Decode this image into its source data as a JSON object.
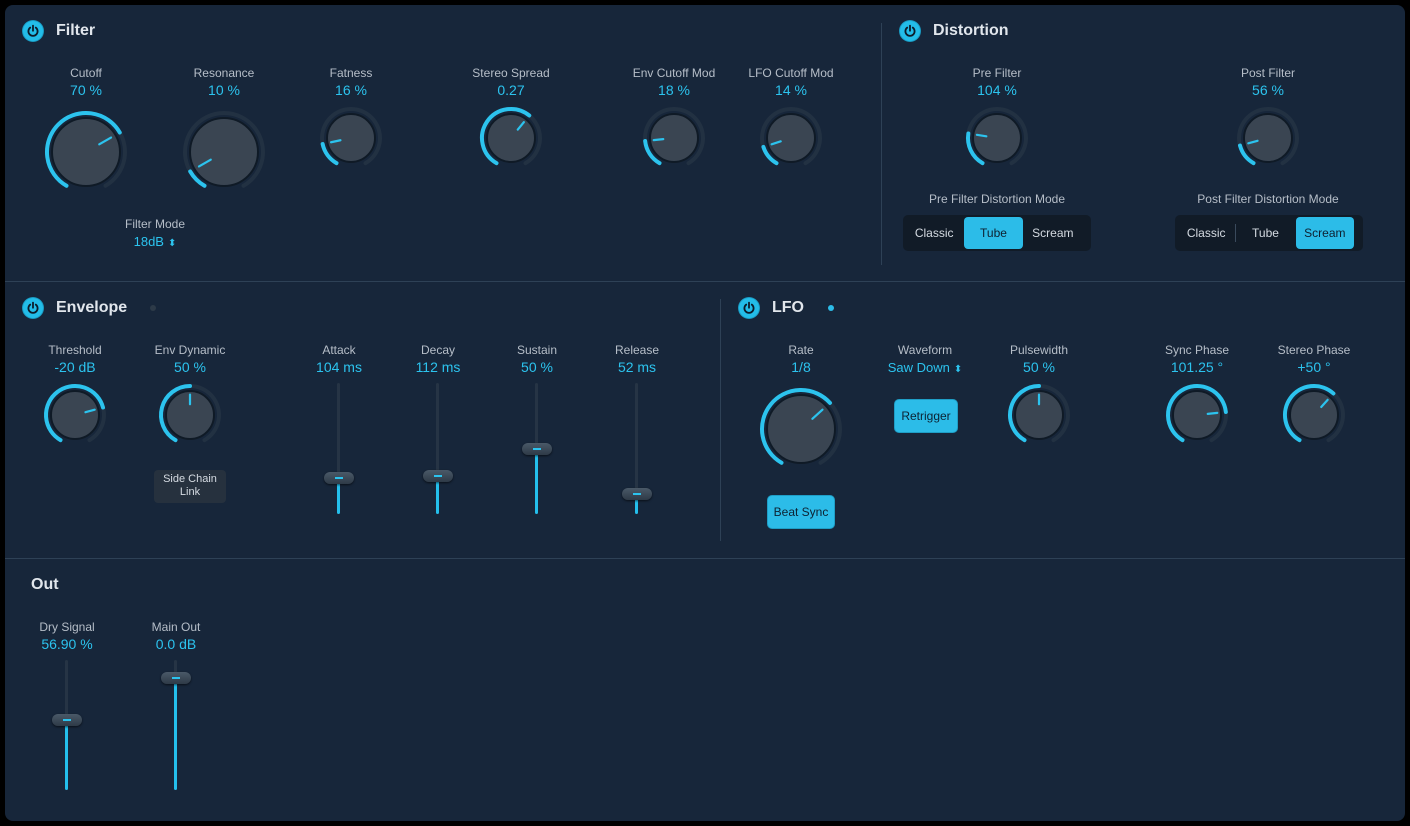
{
  "colors": {
    "accent": "#2cc3ee",
    "panel": "#17263a",
    "track": "#253445",
    "knob": "#3a4552"
  },
  "filter": {
    "title": "Filter",
    "knobs": [
      {
        "id": "cutoff",
        "label": "Cutoff",
        "value": "70 %",
        "fraction": 0.7
      },
      {
        "id": "resonance",
        "label": "Resonance",
        "value": "10 %",
        "fraction": 0.1
      },
      {
        "id": "fatness",
        "label": "Fatness",
        "value": "16 %",
        "fraction": 0.16
      },
      {
        "id": "stereo-spread",
        "label": "Stereo Spread",
        "value": "0.27",
        "fraction": 0.63
      },
      {
        "id": "env-cutoff-mod",
        "label": "Env Cutoff Mod",
        "value": "18 %",
        "fraction": 0.18
      },
      {
        "id": "lfo-cutoff-mod",
        "label": "LFO Cutoff Mod",
        "value": "14 %",
        "fraction": 0.14
      }
    ],
    "mode": {
      "label": "Filter Mode",
      "value": "18dB"
    }
  },
  "distortion": {
    "title": "Distortion",
    "knobs": [
      {
        "id": "pre-filter",
        "label": "Pre Filter",
        "value": "104 %",
        "fraction": 0.23
      },
      {
        "id": "post-filter",
        "label": "Post Filter",
        "value": "56 %",
        "fraction": 0.15
      }
    ],
    "pre_mode": {
      "label": "Pre Filter Distortion Mode",
      "options": [
        "Classic",
        "Tube",
        "Scream"
      ],
      "selected": "Tube"
    },
    "post_mode": {
      "label": "Post Filter Distortion Mode",
      "options": [
        "Classic",
        "Tube",
        "Scream"
      ],
      "selected": "Scream"
    }
  },
  "envelope": {
    "title": "Envelope",
    "knobs": [
      {
        "id": "threshold",
        "label": "Threshold",
        "value": "-20 dB",
        "fraction": 0.75
      },
      {
        "id": "env-dynamic",
        "label": "Env Dynamic",
        "value": "50 %",
        "fraction": 0.5
      }
    ],
    "side_chain_label": "Side Chain Link",
    "sliders": [
      {
        "id": "attack",
        "label": "Attack",
        "value": "104 ms",
        "fraction": 0.25
      },
      {
        "id": "decay",
        "label": "Decay",
        "value": "112 ms",
        "fraction": 0.27
      },
      {
        "id": "sustain",
        "label": "Sustain",
        "value": "50 %",
        "fraction": 0.5
      },
      {
        "id": "release",
        "label": "Release",
        "value": "52 ms",
        "fraction": 0.12
      }
    ]
  },
  "lfo": {
    "title": "LFO",
    "knobs": [
      {
        "id": "rate",
        "label": "Rate",
        "value": "1/8",
        "fraction": 0.66
      },
      {
        "id": "pulsewidth",
        "label": "Pulsewidth",
        "value": "50 %",
        "fraction": 0.5
      },
      {
        "id": "sync-phase",
        "label": "Sync Phase",
        "value": "101.25 °",
        "fraction": 0.78
      },
      {
        "id": "stereo-phase",
        "label": "Stereo Phase",
        "value": "+50 °",
        "fraction": 0.64
      }
    ],
    "waveform": {
      "label": "Waveform",
      "value": "Saw Down"
    },
    "retrigger_label": "Retrigger",
    "beat_sync_label": "Beat Sync"
  },
  "out": {
    "title": "Out",
    "sliders": [
      {
        "id": "dry-signal",
        "label": "Dry Signal",
        "value": "56.90 %",
        "fraction": 0.54
      },
      {
        "id": "main-out",
        "label": "Main Out",
        "value": "0.0 dB",
        "fraction": 0.9
      }
    ]
  }
}
